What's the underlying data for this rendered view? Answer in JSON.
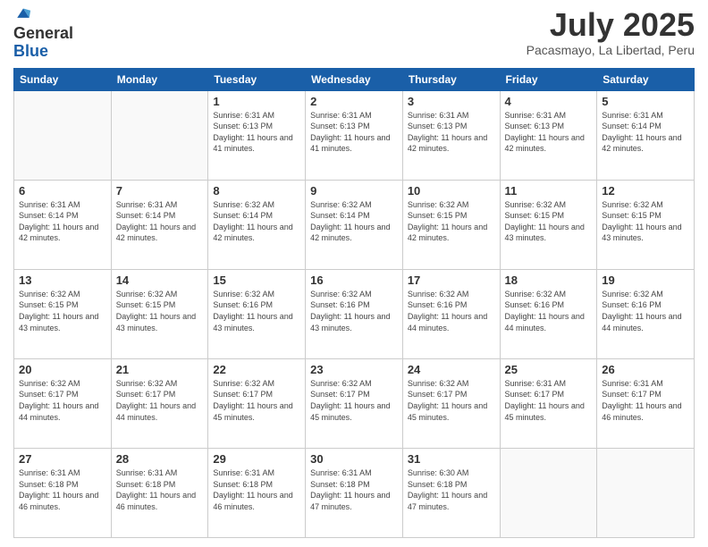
{
  "logo": {
    "general": "General",
    "blue": "Blue"
  },
  "header": {
    "month": "July 2025",
    "location": "Pacasmayo, La Libertad, Peru"
  },
  "weekdays": [
    "Sunday",
    "Monday",
    "Tuesday",
    "Wednesday",
    "Thursday",
    "Friday",
    "Saturday"
  ],
  "weeks": [
    [
      {
        "day": "",
        "info": ""
      },
      {
        "day": "",
        "info": ""
      },
      {
        "day": "1",
        "info": "Sunrise: 6:31 AM\nSunset: 6:13 PM\nDaylight: 11 hours and 41 minutes."
      },
      {
        "day": "2",
        "info": "Sunrise: 6:31 AM\nSunset: 6:13 PM\nDaylight: 11 hours and 41 minutes."
      },
      {
        "day": "3",
        "info": "Sunrise: 6:31 AM\nSunset: 6:13 PM\nDaylight: 11 hours and 42 minutes."
      },
      {
        "day": "4",
        "info": "Sunrise: 6:31 AM\nSunset: 6:13 PM\nDaylight: 11 hours and 42 minutes."
      },
      {
        "day": "5",
        "info": "Sunrise: 6:31 AM\nSunset: 6:14 PM\nDaylight: 11 hours and 42 minutes."
      }
    ],
    [
      {
        "day": "6",
        "info": "Sunrise: 6:31 AM\nSunset: 6:14 PM\nDaylight: 11 hours and 42 minutes."
      },
      {
        "day": "7",
        "info": "Sunrise: 6:31 AM\nSunset: 6:14 PM\nDaylight: 11 hours and 42 minutes."
      },
      {
        "day": "8",
        "info": "Sunrise: 6:32 AM\nSunset: 6:14 PM\nDaylight: 11 hours and 42 minutes."
      },
      {
        "day": "9",
        "info": "Sunrise: 6:32 AM\nSunset: 6:14 PM\nDaylight: 11 hours and 42 minutes."
      },
      {
        "day": "10",
        "info": "Sunrise: 6:32 AM\nSunset: 6:15 PM\nDaylight: 11 hours and 42 minutes."
      },
      {
        "day": "11",
        "info": "Sunrise: 6:32 AM\nSunset: 6:15 PM\nDaylight: 11 hours and 43 minutes."
      },
      {
        "day": "12",
        "info": "Sunrise: 6:32 AM\nSunset: 6:15 PM\nDaylight: 11 hours and 43 minutes."
      }
    ],
    [
      {
        "day": "13",
        "info": "Sunrise: 6:32 AM\nSunset: 6:15 PM\nDaylight: 11 hours and 43 minutes."
      },
      {
        "day": "14",
        "info": "Sunrise: 6:32 AM\nSunset: 6:15 PM\nDaylight: 11 hours and 43 minutes."
      },
      {
        "day": "15",
        "info": "Sunrise: 6:32 AM\nSunset: 6:16 PM\nDaylight: 11 hours and 43 minutes."
      },
      {
        "day": "16",
        "info": "Sunrise: 6:32 AM\nSunset: 6:16 PM\nDaylight: 11 hours and 43 minutes."
      },
      {
        "day": "17",
        "info": "Sunrise: 6:32 AM\nSunset: 6:16 PM\nDaylight: 11 hours and 44 minutes."
      },
      {
        "day": "18",
        "info": "Sunrise: 6:32 AM\nSunset: 6:16 PM\nDaylight: 11 hours and 44 minutes."
      },
      {
        "day": "19",
        "info": "Sunrise: 6:32 AM\nSunset: 6:16 PM\nDaylight: 11 hours and 44 minutes."
      }
    ],
    [
      {
        "day": "20",
        "info": "Sunrise: 6:32 AM\nSunset: 6:17 PM\nDaylight: 11 hours and 44 minutes."
      },
      {
        "day": "21",
        "info": "Sunrise: 6:32 AM\nSunset: 6:17 PM\nDaylight: 11 hours and 44 minutes."
      },
      {
        "day": "22",
        "info": "Sunrise: 6:32 AM\nSunset: 6:17 PM\nDaylight: 11 hours and 45 minutes."
      },
      {
        "day": "23",
        "info": "Sunrise: 6:32 AM\nSunset: 6:17 PM\nDaylight: 11 hours and 45 minutes."
      },
      {
        "day": "24",
        "info": "Sunrise: 6:32 AM\nSunset: 6:17 PM\nDaylight: 11 hours and 45 minutes."
      },
      {
        "day": "25",
        "info": "Sunrise: 6:31 AM\nSunset: 6:17 PM\nDaylight: 11 hours and 45 minutes."
      },
      {
        "day": "26",
        "info": "Sunrise: 6:31 AM\nSunset: 6:17 PM\nDaylight: 11 hours and 46 minutes."
      }
    ],
    [
      {
        "day": "27",
        "info": "Sunrise: 6:31 AM\nSunset: 6:18 PM\nDaylight: 11 hours and 46 minutes."
      },
      {
        "day": "28",
        "info": "Sunrise: 6:31 AM\nSunset: 6:18 PM\nDaylight: 11 hours and 46 minutes."
      },
      {
        "day": "29",
        "info": "Sunrise: 6:31 AM\nSunset: 6:18 PM\nDaylight: 11 hours and 46 minutes."
      },
      {
        "day": "30",
        "info": "Sunrise: 6:31 AM\nSunset: 6:18 PM\nDaylight: 11 hours and 47 minutes."
      },
      {
        "day": "31",
        "info": "Sunrise: 6:30 AM\nSunset: 6:18 PM\nDaylight: 11 hours and 47 minutes."
      },
      {
        "day": "",
        "info": ""
      },
      {
        "day": "",
        "info": ""
      }
    ]
  ]
}
